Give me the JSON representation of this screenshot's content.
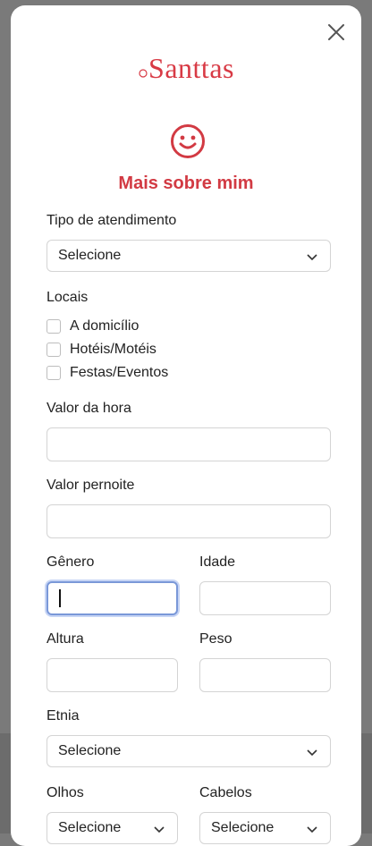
{
  "header": {
    "logo_text": "Santtas",
    "title": "Mais sobre mim"
  },
  "form": {
    "tipo_label": "Tipo de atendimento",
    "tipo_value": "Selecione",
    "locais_label": "Locais",
    "locais": [
      "A domicílio",
      "Hotéis/Motéis",
      "Festas/Eventos"
    ],
    "valor_hora_label": "Valor da hora",
    "valor_pernoite_label": "Valor pernoite",
    "genero_label": "Gênero",
    "idade_label": "Idade",
    "altura_label": "Altura",
    "peso_label": "Peso",
    "etnia_label": "Etnia",
    "etnia_value": "Selecione",
    "olhos_label": "Olhos",
    "olhos_value": "Selecione",
    "cabelos_label": "Cabelos",
    "cabelos_value": "Selecione"
  },
  "colors": {
    "brand": "#d83a45",
    "focus": "#7a98d8"
  },
  "icons": {
    "close": "close-icon",
    "smiley": "smiley-icon",
    "chevron": "chevron-down-icon"
  }
}
